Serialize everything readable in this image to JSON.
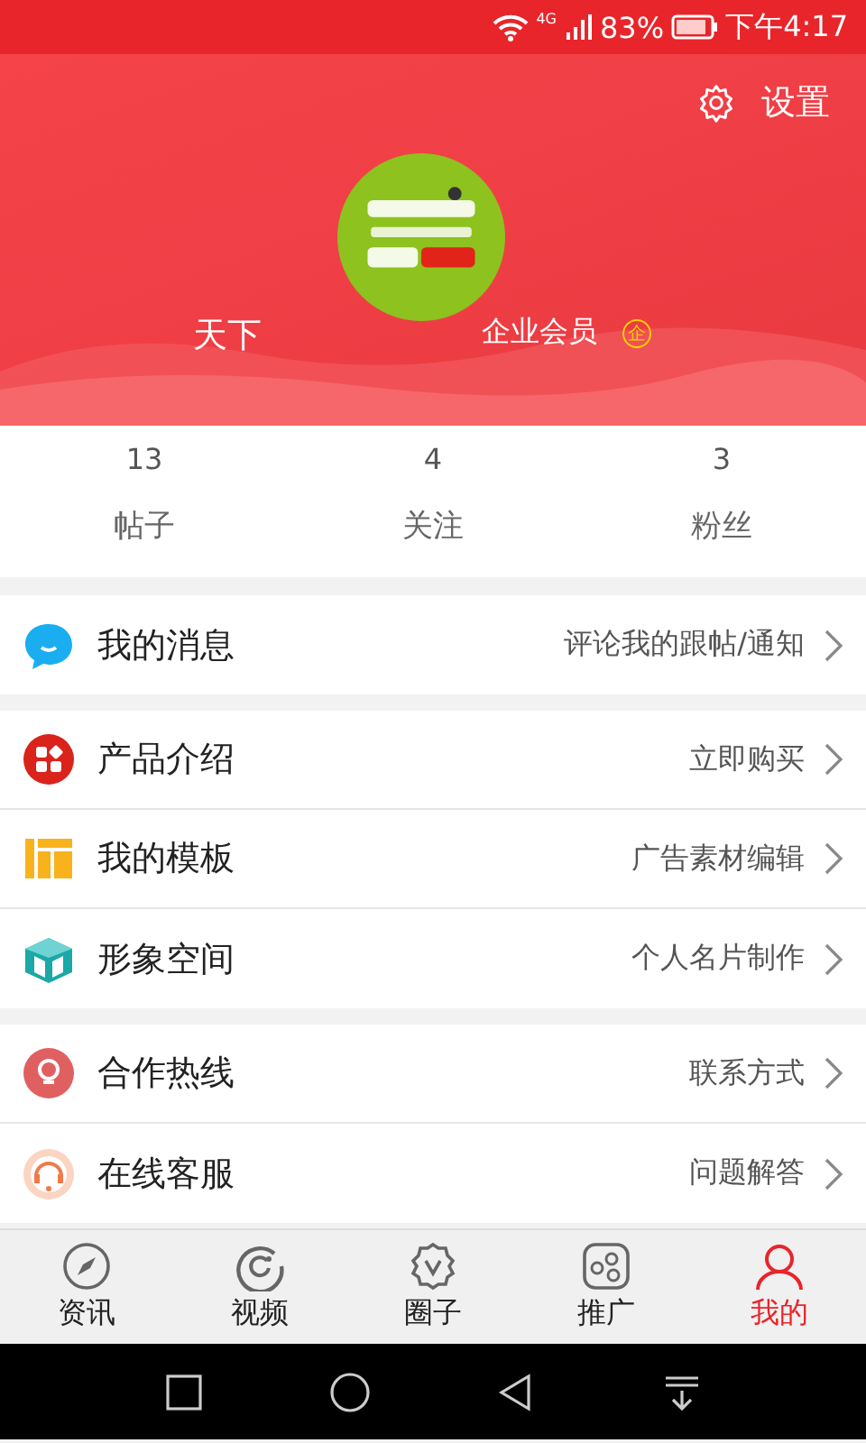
{
  "status_bar": {
    "network": "4G",
    "battery": "83%",
    "time": "下午4:17"
  },
  "header": {
    "settings": "设置",
    "name": "天下",
    "membership": "企业会员",
    "badge": "企"
  },
  "stats": [
    {
      "count": "13",
      "label": "帖子"
    },
    {
      "count": "4",
      "label": "关注"
    },
    {
      "count": "3",
      "label": "粉丝"
    }
  ],
  "menu_groups": [
    {
      "items": [
        {
          "title": "我的消息",
          "detail": "评论我的跟帖/通知"
        }
      ]
    },
    {
      "items": [
        {
          "title": "产品介绍",
          "detail": "立即购买"
        },
        {
          "title": "我的模板",
          "detail": "广告素材编辑"
        },
        {
          "title": "形象空间",
          "detail": "个人名片制作"
        }
      ]
    },
    {
      "items": [
        {
          "title": "合作热线",
          "detail": "联系方式"
        },
        {
          "title": "在线客服",
          "detail": "问题解答"
        }
      ]
    }
  ],
  "tabs": [
    {
      "label": "资讯",
      "selected": false
    },
    {
      "label": "视频",
      "selected": false
    },
    {
      "label": "圈子",
      "selected": false
    },
    {
      "label": "推广",
      "selected": false
    },
    {
      "label": "我的",
      "selected": true
    }
  ]
}
